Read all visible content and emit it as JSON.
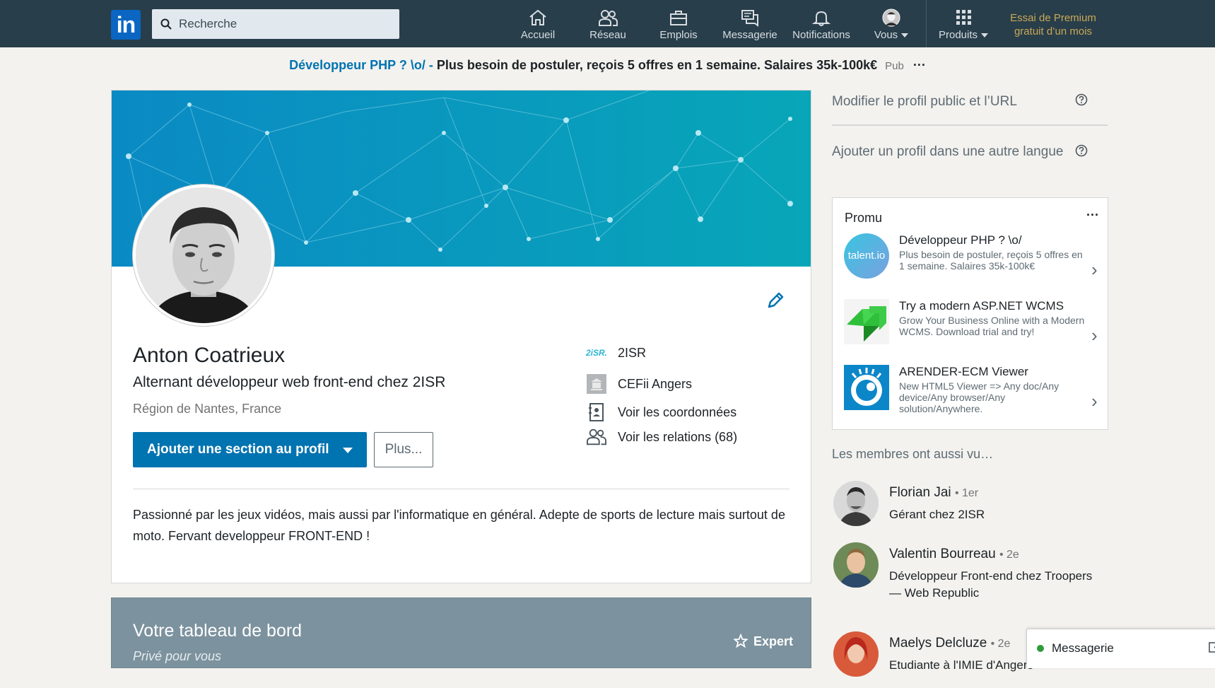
{
  "nav": {
    "logo": "in",
    "search_placeholder": "Recherche",
    "items": [
      {
        "label": "Accueil",
        "icon": "home-icon"
      },
      {
        "label": "Réseau",
        "icon": "network-icon"
      },
      {
        "label": "Emplois",
        "icon": "briefcase-icon"
      },
      {
        "label": "Messagerie",
        "icon": "chat-icon"
      },
      {
        "label": "Notifications",
        "icon": "bell-icon"
      },
      {
        "label": "Vous",
        "icon": "profile-avatar-icon"
      },
      {
        "label": "Produits",
        "icon": "grid-icon"
      }
    ],
    "premium": "Essai de Premium gratuit d’un mois"
  },
  "ad_banner": {
    "headline": "Développeur PHP ? \\o/ -",
    "text": "Plus besoin de postuler, reçois 5 offres en 1 semaine. Salaires 35k-100k€",
    "tag": "Pub",
    "more": "···"
  },
  "profile": {
    "name": "Anton Coatrieux",
    "headline": "Alternant développeur web front-end chez 2ISR",
    "location": "Région de Nantes, France",
    "add_section_label": "Ajouter une section au profil",
    "more_label": "Plus...",
    "company_logo_text": "2iSR.",
    "company": "2ISR",
    "school": "CEFii Angers",
    "contact_label": "Voir les coordonnées",
    "connections_label": "Voir les relations (68)",
    "summary": "Passionné par les jeux vidéos, mais aussi par l'informatique en général. Adepte de sports de lecture mais surtout de moto. Fervant developpeur FRONT-END !"
  },
  "dashboard": {
    "title": "Votre tableau de bord",
    "subtitle": "Privé pour vous",
    "expert_label": "Expert"
  },
  "rail": {
    "edit_public_profile": "Modifier le profil public et l’URL",
    "add_language_profile": "Ajouter un profil dans une autre langue",
    "promo": {
      "title": "Promu",
      "more": "···",
      "items": [
        {
          "title": "Développeur PHP ? \\o/",
          "desc": "Plus besoin de postuler, reçois 5 offres en 1 semaine. Salaires 35k-100k€",
          "logo_text": "talent.io"
        },
        {
          "title": "Try a modern ASP.NET WCMS",
          "desc": "Grow Your Business Online with a Modern WCMS. Download trial and try!"
        },
        {
          "title": "ARENDER-ECM Viewer",
          "desc": "New HTML5 Viewer => Any doc/Any device/Any browser/Any solution/Anywhere."
        }
      ]
    },
    "also_viewed_title": "Les membres ont aussi vu…",
    "members": [
      {
        "name": "Florian Jai",
        "degree": "• 1er",
        "headline": "Gérant chez 2ISR"
      },
      {
        "name": "Valentin Bourreau",
        "degree": "• 2e",
        "headline": "Développeur Front-end chez Troopers — Web Republic"
      },
      {
        "name": "Maelys Delcluze",
        "degree": "• 2e",
        "headline": "Etudiante à l'IMIE d'Angers"
      }
    ]
  },
  "messaging": {
    "label": "Messagerie"
  },
  "colors": {
    "nav_bg": "#283e4a",
    "primary": "#0073b1",
    "premium_gold": "#c9a858",
    "cover_teal": "#0a8db3"
  }
}
